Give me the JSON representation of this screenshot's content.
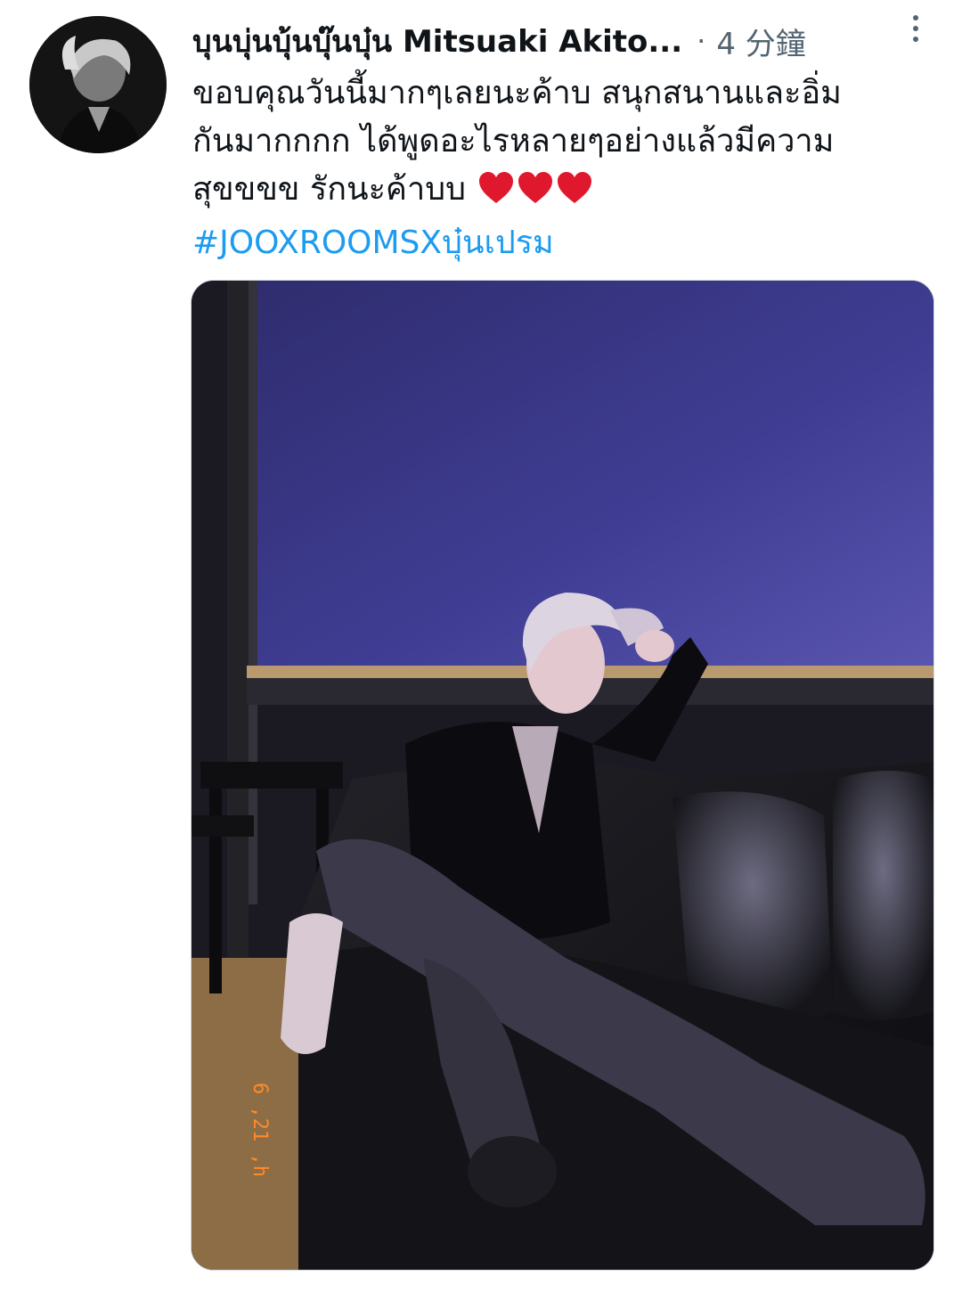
{
  "tweet": {
    "display_name": "บุนบุ่นบุ้นบุ๊นบุ๋น Mitsuaki Akito...",
    "separator": "·",
    "time": "4 分鐘",
    "text_lines": [
      "ขอบคุณวันนี้มากๆเลยนะค้าบ สนุกสนานและอิ่ม",
      "กันมากกกก ได้พูดอะไรหลายๆอย่างแล้วมีความ",
      "สุขขขข รักนะค้าบบ"
    ],
    "hashtag": "#JOOXROOMSXบุ๋นเปรม",
    "hearts_icon": "red-heart-emoji",
    "heart_count": 3,
    "media_date_stamp": "6 ,21 ,h"
  },
  "icons": {
    "more": "more-vertical-icon",
    "avatar": "profile-avatar"
  },
  "colors": {
    "text": "#0f1419",
    "secondary": "#536471",
    "link": "#1d9bf0",
    "heart": "#e0182d",
    "wall": "#3b3a8c",
    "sofa": "#121214"
  }
}
